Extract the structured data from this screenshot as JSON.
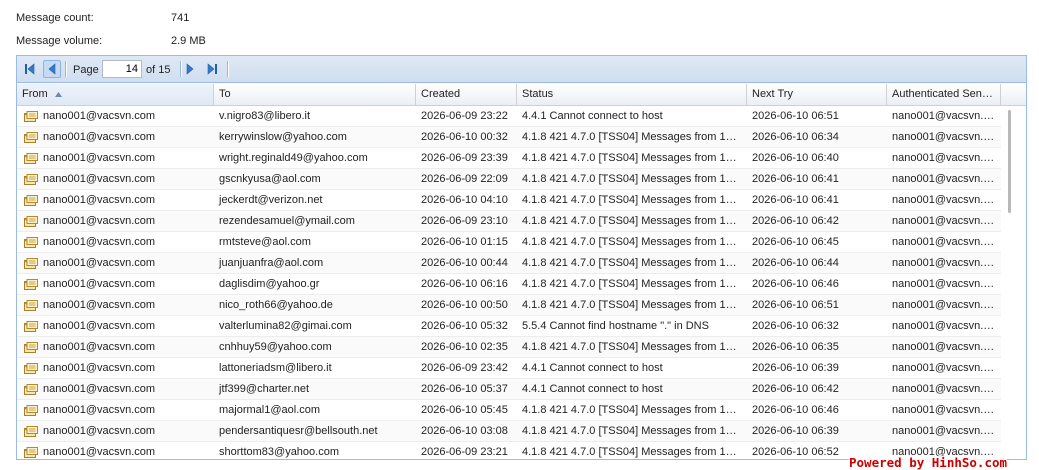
{
  "summary": {
    "message_count_label": "Message count:",
    "message_count_value": "741",
    "message_volume_label": "Message volume:",
    "message_volume_value": "2.9 MB"
  },
  "pager": {
    "page_label": "Page",
    "current_page": "14",
    "of_label": "of 15",
    "icons": [
      "first-page-icon",
      "prev-page-icon",
      "next-page-icon",
      "last-page-icon"
    ]
  },
  "columns": [
    {
      "label": "From",
      "sorted": "asc"
    },
    {
      "label": "To"
    },
    {
      "label": "Created"
    },
    {
      "label": "Status"
    },
    {
      "label": "Next Try"
    },
    {
      "label": "Authenticated Sen…"
    }
  ],
  "rows": [
    {
      "from": "nano001@vacsvn.com",
      "to": "v.nigro83@libero.it",
      "created": "2026-06-09 23:22",
      "status": "4.4.1 Cannot connect to host",
      "next_try": "2026-06-10 06:51",
      "auth": "nano001@vacsvn.…"
    },
    {
      "from": "nano001@vacsvn.com",
      "to": "kerrywinslow@yahoo.com",
      "created": "2026-06-10 00:32",
      "status": "4.1.8 421 4.7.0 [TSS04] Messages from 1…",
      "next_try": "2026-06-10 06:34",
      "auth": "nano001@vacsvn.…"
    },
    {
      "from": "nano001@vacsvn.com",
      "to": "wright.reginald49@yahoo.com",
      "created": "2026-06-09 23:39",
      "status": "4.1.8 421 4.7.0 [TSS04] Messages from 1…",
      "next_try": "2026-06-10 06:40",
      "auth": "nano001@vacsvn.…"
    },
    {
      "from": "nano001@vacsvn.com",
      "to": "gscnkyusa@aol.com",
      "created": "2026-06-09 22:09",
      "status": "4.1.8 421 4.7.0 [TSS04] Messages from 1…",
      "next_try": "2026-06-10 06:41",
      "auth": "nano001@vacsvn.…"
    },
    {
      "from": "nano001@vacsvn.com",
      "to": "jeckerdt@verizon.net",
      "created": "2026-06-10 04:10",
      "status": "4.1.8 421 4.7.0 [TSS04] Messages from 1…",
      "next_try": "2026-06-10 06:41",
      "auth": "nano001@vacsvn.…"
    },
    {
      "from": "nano001@vacsvn.com",
      "to": "rezendesamuel@ymail.com",
      "created": "2026-06-09 23:10",
      "status": "4.1.8 421 4.7.0 [TSS04] Messages from 1…",
      "next_try": "2026-06-10 06:42",
      "auth": "nano001@vacsvn.…"
    },
    {
      "from": "nano001@vacsvn.com",
      "to": "rmtsteve@aol.com",
      "created": "2026-06-10 01:15",
      "status": "4.1.8 421 4.7.0 [TSS04] Messages from 1…",
      "next_try": "2026-06-10 06:45",
      "auth": "nano001@vacsvn.…"
    },
    {
      "from": "nano001@vacsvn.com",
      "to": "juanjuanfra@aol.com",
      "created": "2026-06-10 00:44",
      "status": "4.1.8 421 4.7.0 [TSS04] Messages from 1…",
      "next_try": "2026-06-10 06:44",
      "auth": "nano001@vacsvn.…"
    },
    {
      "from": "nano001@vacsvn.com",
      "to": "daglisdim@yahoo.gr",
      "created": "2026-06-10 06:16",
      "status": "4.1.8 421 4.7.0 [TSS04] Messages from 1…",
      "next_try": "2026-06-10 06:46",
      "auth": "nano001@vacsvn.…"
    },
    {
      "from": "nano001@vacsvn.com",
      "to": "nico_roth66@yahoo.de",
      "created": "2026-06-10 00:50",
      "status": "4.1.8 421 4.7.0 [TSS04] Messages from 1…",
      "next_try": "2026-06-10 06:51",
      "auth": "nano001@vacsvn.…"
    },
    {
      "from": "nano001@vacsvn.com",
      "to": "valterlumina82@gimai.com",
      "created": "2026-06-10 05:32",
      "status": "5.5.4 Cannot find hostname \".\" in DNS",
      "next_try": "2026-06-10 06:32",
      "auth": "nano001@vacsvn.…"
    },
    {
      "from": "nano001@vacsvn.com",
      "to": "cnhhuy59@yahoo.com",
      "created": "2026-06-10 02:35",
      "status": "4.1.8 421 4.7.0 [TSS04] Messages from 1…",
      "next_try": "2026-06-10 06:35",
      "auth": "nano001@vacsvn.…"
    },
    {
      "from": "nano001@vacsvn.com",
      "to": "lattoneriadsm@libero.it",
      "created": "2026-06-09 23:42",
      "status": "4.4.1 Cannot connect to host",
      "next_try": "2026-06-10 06:39",
      "auth": "nano001@vacsvn.…"
    },
    {
      "from": "nano001@vacsvn.com",
      "to": "jtf399@charter.net",
      "created": "2026-06-10 05:37",
      "status": "4.4.1 Cannot connect to host",
      "next_try": "2026-06-10 06:42",
      "auth": "nano001@vacsvn.…"
    },
    {
      "from": "nano001@vacsvn.com",
      "to": "majormal1@aol.com",
      "created": "2026-06-10 05:45",
      "status": "4.1.8 421 4.7.0 [TSS04] Messages from 1…",
      "next_try": "2026-06-10 06:46",
      "auth": "nano001@vacsvn.…"
    },
    {
      "from": "nano001@vacsvn.com",
      "to": "pendersantiquesr@bellsouth.net",
      "created": "2026-06-10 03:08",
      "status": "4.1.8 421 4.7.0 [TSS04] Messages from 1…",
      "next_try": "2026-06-10 06:39",
      "auth": "nano001@vacsvn.…"
    },
    {
      "from": "nano001@vacsvn.com",
      "to": "shorttom83@yahoo.com",
      "created": "2026-06-09 23:21",
      "status": "4.1.8 421 4.7.0 [TSS04] Messages from 1…",
      "next_try": "2026-06-10 06:52",
      "auth": "nano001@vacsvn.…"
    }
  ],
  "footer": {
    "credit": "Powered by HinhSo.com"
  }
}
